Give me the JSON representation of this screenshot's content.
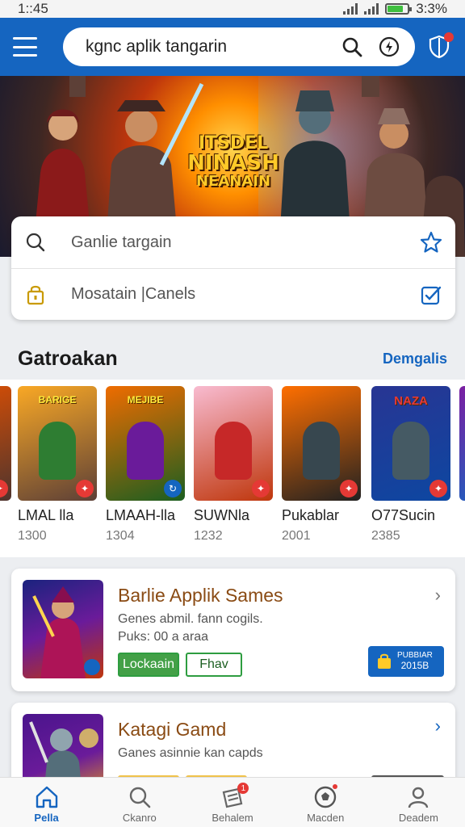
{
  "status_bar": {
    "time": "1::45",
    "battery": "3:3%",
    "battery_level": 0.8
  },
  "search": {
    "query": "kgnc aplik tangarin"
  },
  "hero": {
    "title_line1": "ITSDEL",
    "title_line2": "NINASH",
    "title_line3": "NEANAIN"
  },
  "quick_actions": [
    {
      "label": "Ganlie targain",
      "icon": "search-icon",
      "action_icon": "star-icon"
    },
    {
      "label": "Mosatain |Canels",
      "icon": "lock-icon",
      "action_icon": "edit-check-icon"
    }
  ],
  "section": {
    "title": "Gatroakan",
    "link": "Demgalis"
  },
  "games": [
    {
      "name": "LMAL lla",
      "count": "1300",
      "caption": "BARIGE",
      "colors": [
        "#f9a825",
        "#5d4037"
      ],
      "fig": "#2e7d32",
      "badge": "#e53935"
    },
    {
      "name": "LMAAH-lla",
      "count": "1304",
      "caption": "MEJIBE",
      "colors": [
        "#ef6c00",
        "#1b5e20"
      ],
      "fig": "#6a1b9a",
      "badge": "#1565c0"
    },
    {
      "name": "SUWNla",
      "count": "1232",
      "caption": "",
      "colors": [
        "#f8bbd0",
        "#bf360c"
      ],
      "fig": "#c62828",
      "badge": "#e53935"
    },
    {
      "name": "Pukablar",
      "count": "2001",
      "caption": "",
      "colors": [
        "#ff6f00",
        "#212121"
      ],
      "fig": "#37474f",
      "badge": "#e53935"
    },
    {
      "name": "O77Sucin",
      "count": "2385",
      "caption": "NAZA",
      "colors": [
        "#283593",
        "#0d47a1"
      ],
      "fig": "#455a64",
      "badge": "#e53935"
    }
  ],
  "cards": [
    {
      "title": "Barlie Applik Sames",
      "line1": "Genes abmil. fann cogils.",
      "line2": "Puks: 00 a araa",
      "button1": "Lockaain",
      "button2": "Fhav",
      "buy_line1": "PUBBIAR",
      "buy_line2": "2015B"
    },
    {
      "title": "Katagi Gamd",
      "line1": "Ganes asinnie kan capds"
    }
  ],
  "nav": [
    {
      "label": "Pella",
      "icon": "home-icon",
      "active": true
    },
    {
      "label": "Ckanro",
      "icon": "search-icon"
    },
    {
      "label": "Behalem",
      "icon": "library-icon",
      "badge": "1"
    },
    {
      "label": "Macden",
      "icon": "football-icon"
    },
    {
      "label": "Deadem",
      "icon": "profile-icon"
    }
  ],
  "colors": {
    "primary": "#1565c0",
    "accent_green": "#2e9d40",
    "title_brown": "#8a4b14"
  }
}
